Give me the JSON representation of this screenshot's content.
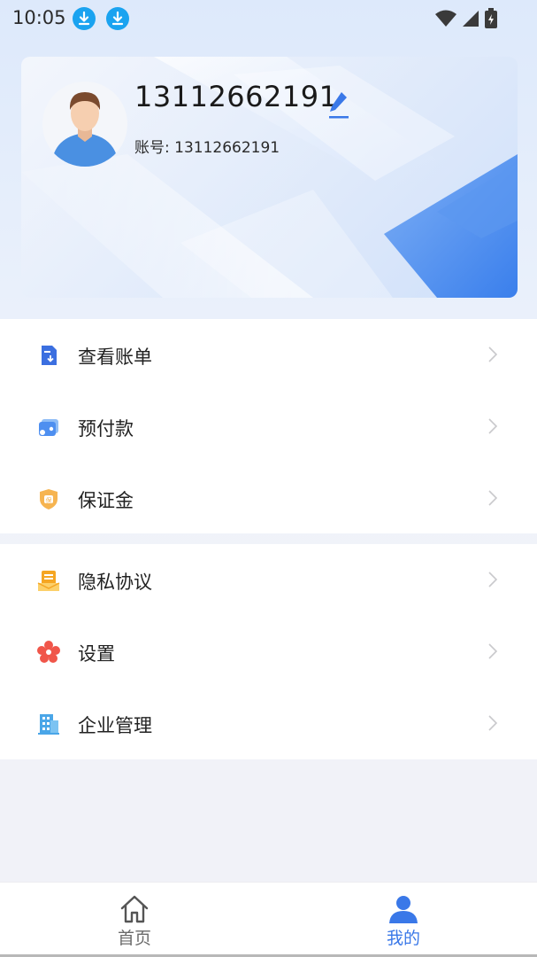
{
  "status_bar": {
    "time": "10:05",
    "icons": [
      "download-icon",
      "download-icon",
      "wifi-icon",
      "signal-icon",
      "battery-charging-icon"
    ]
  },
  "profile": {
    "phone": "13112662191",
    "account_label": "账号:",
    "account_value": "13112662191",
    "avatar_icon": "avatar-placeholder-icon",
    "edit_icon": "pencil-icon"
  },
  "menu": {
    "group1": [
      {
        "label": "查看账单",
        "icon": "bill-icon"
      },
      {
        "label": "预付款",
        "icon": "wallet-icon"
      },
      {
        "label": "保证金",
        "icon": "shield-deposit-icon"
      }
    ],
    "group2": [
      {
        "label": "隐私协议",
        "icon": "privacy-icon"
      },
      {
        "label": "设置",
        "icon": "settings-flower-icon"
      },
      {
        "label": "企业管理",
        "icon": "building-icon"
      }
    ]
  },
  "tabbar": {
    "home": "首页",
    "mine": "我的",
    "active": "mine"
  },
  "colors": {
    "accent": "#3a78e8",
    "download_badge": "#1aa3f0",
    "settings_icon": "#f0564a",
    "privacy_icon": "#f5a623"
  }
}
